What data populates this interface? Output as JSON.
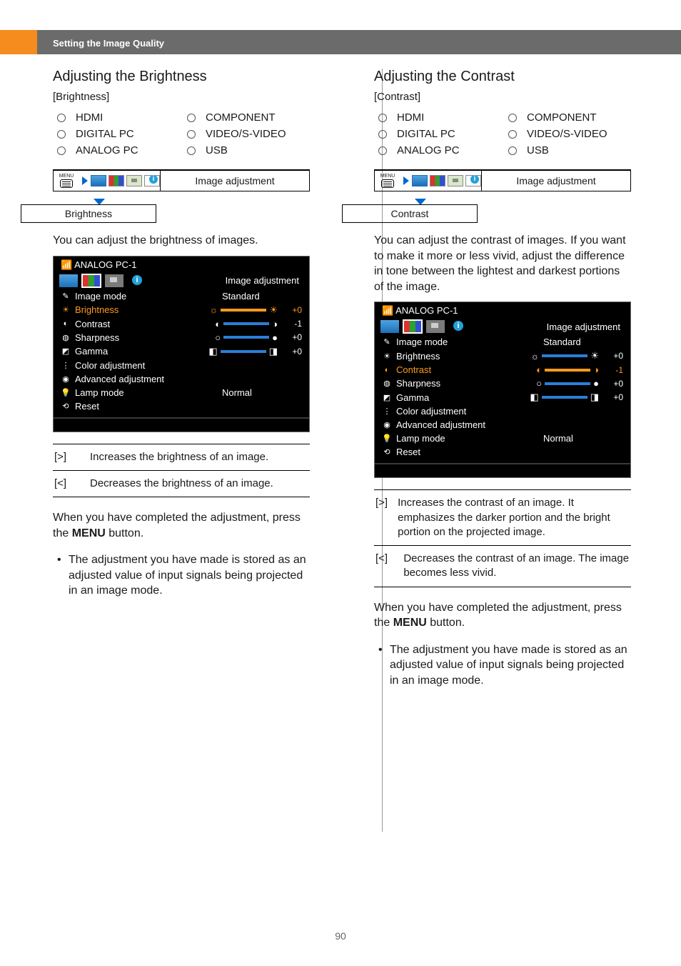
{
  "header": {
    "breadcrumb": "Setting the Image Quality"
  },
  "page_number": "90",
  "left": {
    "title": "Adjusting the Brightness",
    "subhead": "[Brightness]",
    "radios": [
      "HDMI",
      "COMPONENT",
      "DIGITAL PC",
      "VIDEO/S-VIDEO",
      "ANALOG PC",
      "USB"
    ],
    "nav": {
      "menu": "MENU",
      "top_label": "Image adjustment",
      "sub_label": "Brightness"
    },
    "desc": "You can adjust the brightness of images.",
    "osd": {
      "source": "ANALOG PC-1",
      "tab_title": "Image adjustment",
      "rows": [
        {
          "label": "Image mode",
          "value_text": "Standard"
        },
        {
          "label": "Brightness",
          "value_num": "+0",
          "selected": true
        },
        {
          "label": "Contrast",
          "value_num": "-1"
        },
        {
          "label": "Sharpness",
          "value_num": "+0"
        },
        {
          "label": "Gamma",
          "value_num": "+0"
        },
        {
          "label": "Color adjustment"
        },
        {
          "label": "Advanced adjustment"
        },
        {
          "label": "Lamp mode",
          "value_text": "Normal"
        },
        {
          "label": "Reset"
        }
      ]
    },
    "keys": [
      {
        "sym": "[>]",
        "desc": "Increases the brightness of an image."
      },
      {
        "sym": "[<]",
        "desc": "Decreases the brightness of an image."
      }
    ],
    "closing": {
      "pre": "When you have completed the adjustment, press the ",
      "menu": "MENU",
      "post": " button."
    },
    "bullet": "The adjustment you have made is stored as an adjusted value of input signals being projected in an image mode."
  },
  "right": {
    "title": "Adjusting the Contrast",
    "subhead": "[Contrast]",
    "radios": [
      "HDMI",
      "COMPONENT",
      "DIGITAL PC",
      "VIDEO/S-VIDEO",
      "ANALOG PC",
      "USB"
    ],
    "nav": {
      "menu": "MENU",
      "top_label": "Image adjustment",
      "sub_label": "Contrast"
    },
    "desc": "You can adjust the contrast of images. If you want to make it more or less vivid, adjust the difference in tone between the lightest and darkest portions of the image.",
    "osd": {
      "source": "ANALOG PC-1",
      "tab_title": "Image adjustment",
      "rows": [
        {
          "label": "Image mode",
          "value_text": "Standard"
        },
        {
          "label": "Brightness",
          "value_num": "+0"
        },
        {
          "label": "Contrast",
          "value_num": "-1",
          "selected": true
        },
        {
          "label": "Sharpness",
          "value_num": "+0"
        },
        {
          "label": "Gamma",
          "value_num": "+0"
        },
        {
          "label": "Color adjustment"
        },
        {
          "label": "Advanced adjustment"
        },
        {
          "label": "Lamp mode",
          "value_text": "Normal"
        },
        {
          "label": "Reset"
        }
      ]
    },
    "keys": [
      {
        "sym": "[>]",
        "desc": "Increases the contrast of an image. It emphasizes the darker portion and the bright portion on the projected image."
      },
      {
        "sym": "[<]",
        "desc": "Decreases the contrast of an image. The image becomes less vivid."
      }
    ],
    "closing": {
      "pre": "When you have completed the adjustment, press the ",
      "menu": "MENU",
      "post": " button."
    },
    "bullet": "The adjustment you have made is stored as an adjusted value of input signals being projected in an image mode."
  }
}
